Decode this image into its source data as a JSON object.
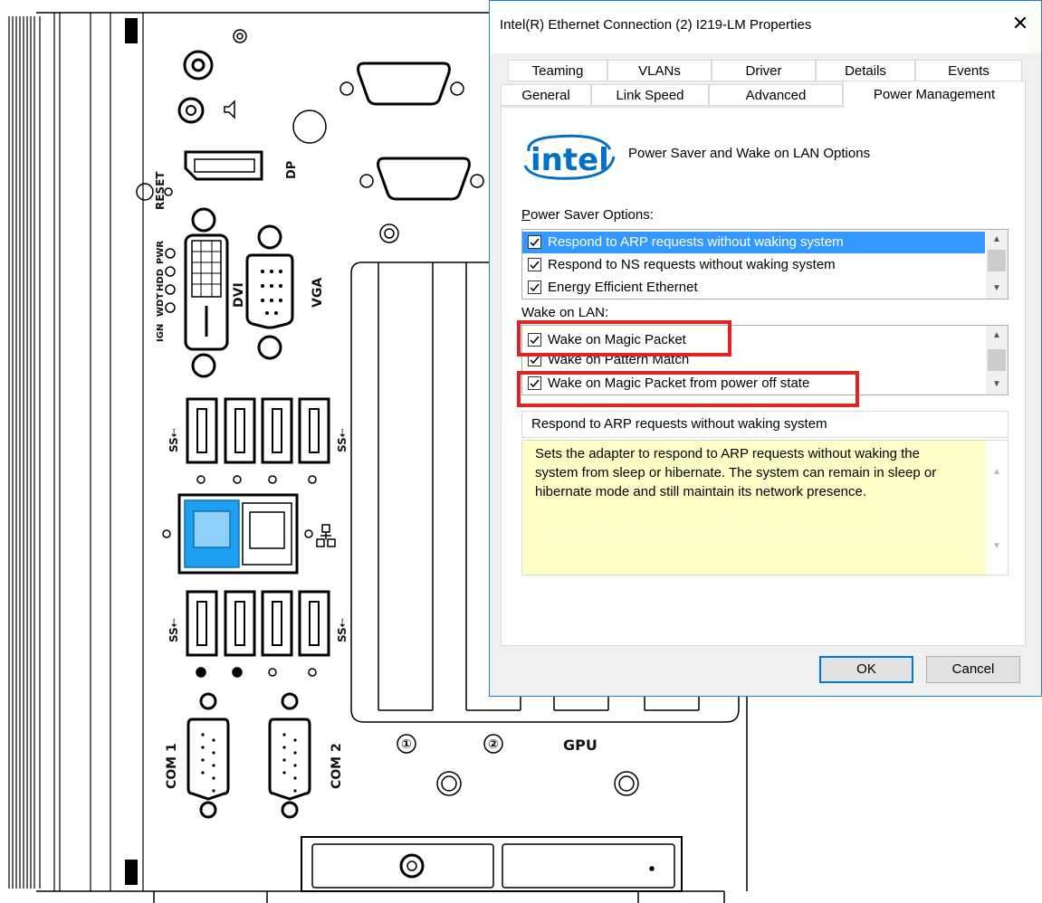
{
  "dialog": {
    "title": "Intel(R) Ethernet Connection (2) I219-LM Properties",
    "close_glyph": "✕",
    "tabs_row1": [
      "Teaming",
      "VLANs",
      "Driver",
      "Details",
      "Events"
    ],
    "tabs_row2": [
      "General",
      "Link Speed",
      "Advanced",
      "Power Management"
    ],
    "active_tab": "Power Management",
    "logo_text": "intel",
    "header_text": "Power Saver and Wake on LAN Options",
    "power_saver_label_ul": "P",
    "power_saver_label_rest": "ower Saver Options:",
    "power_saver_items": [
      {
        "label": "Respond to ARP requests without waking system",
        "checked": true,
        "selected": true
      },
      {
        "label": "Respond to NS requests without waking system",
        "checked": true,
        "selected": false
      },
      {
        "label": "Energy Efficient Ethernet",
        "checked": true,
        "selected": false
      }
    ],
    "wake_label": "Wake on LAN:",
    "wake_items": [
      {
        "label": "Wake on Magic Packet",
        "checked": true,
        "highlighted": true
      },
      {
        "label": "Wake on Pattern Match",
        "checked": true,
        "highlighted": false
      },
      {
        "label": "Wake on Magic Packet from power off state",
        "checked": true,
        "highlighted": true
      }
    ],
    "description_title": "Respond to ARP requests without waking system",
    "description_text": "Sets the adapter to respond to ARP requests without waking the system from sleep or hibernate. The system can remain in sleep or hibernate mode and still maintain its network presence.",
    "ok_label": "OK",
    "cancel_label": "Cancel",
    "highlight_color": "#e32221",
    "selection_color": "#3399ff",
    "description_bg": "#ffffc8"
  },
  "panel": {
    "reset_label": "RESET",
    "dp_label": "DP",
    "led_labels": [
      "IGN",
      "WDT",
      "HDD",
      "PWR"
    ],
    "dvi_label": "DVI",
    "vga_label": "VGA",
    "usb_label": "SS⇠",
    "com1_label": "COM 1",
    "com2_label": "COM 2",
    "slot1_label": "①",
    "slot2_label": "②",
    "gpu_label": "GPU",
    "lan_icon": "network-icon"
  }
}
